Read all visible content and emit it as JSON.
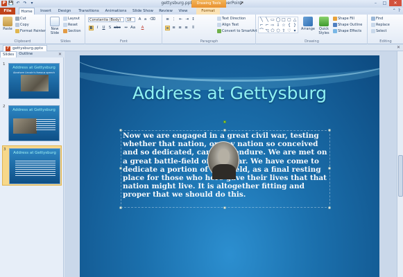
{
  "window": {
    "title": "gettysburg.pptx - Microsoft PowerPoint",
    "context_tab_title": "Drawing Tools",
    "qat": [
      "P",
      "💾",
      "↶",
      "↷",
      "▾"
    ],
    "controls": [
      "–",
      "□",
      "✕"
    ]
  },
  "tabs": [
    "File",
    "Home",
    "Insert",
    "Design",
    "Transitions",
    "Animations",
    "Slide Show",
    "Review",
    "View",
    "Format"
  ],
  "ribbon": {
    "clipboard": {
      "label": "Clipboard",
      "paste": "Paste",
      "cut": "Cut",
      "copy": "Copy",
      "format_painter": "Format Painter"
    },
    "slides": {
      "label": "Slides",
      "new_slide": "New Slide",
      "layout": "Layout",
      "reset": "Reset",
      "section": "Section"
    },
    "font": {
      "label": "Font",
      "font_name": "Constantia (Body)",
      "font_size": "18"
    },
    "paragraph": {
      "label": "Paragraph",
      "text_direction": "Text Direction",
      "align_text": "Align Text",
      "convert_smartart": "Convert to SmartArt"
    },
    "drawing": {
      "label": "Drawing",
      "arrange": "Arrange",
      "quick_styles": "Quick Styles",
      "shape_fill": "Shape Fill",
      "shape_outline": "Shape Outline",
      "shape_effects": "Shape Effects"
    },
    "editing": {
      "label": "Editing",
      "find": "Find",
      "replace": "Replace",
      "select": "Select"
    }
  },
  "document_tab": "gettysburg.pptx",
  "sidebar": {
    "tabs": [
      "Slides",
      "Outline"
    ],
    "thumbnails": [
      {
        "number": "1",
        "title": "Address at Gettysburg",
        "subtitle": "Abraham Lincoln's famous speech"
      },
      {
        "number": "2",
        "title": "Address at Gettysburg",
        "subtitle": ""
      },
      {
        "number": "3",
        "title": "Address at Gettysburg",
        "subtitle": ""
      }
    ],
    "selected_index": 3
  },
  "slide": {
    "title": "Address at Gettysburg",
    "body": "Now we are engaged in a great civil war, testing whether that nation, or any nation so conceived and so dedicated, can long endure. We are met on a great battle-field of that war. We have come to dedicate a portion of that field, as a final resting place for those who here gave their lives that that nation might live. It is altogether fitting and proper that we should do this."
  }
}
